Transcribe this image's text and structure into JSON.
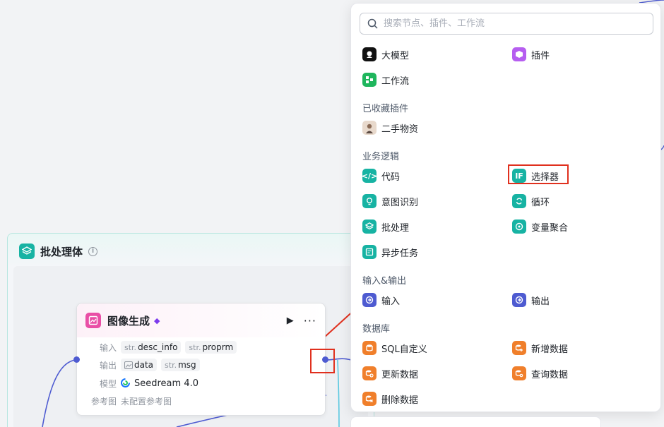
{
  "batch": {
    "title": "批处理体",
    "info_icon": "i"
  },
  "node": {
    "title": "图像生成",
    "input_label": "输入",
    "inputs": [
      {
        "type": "str.",
        "name": "desc_info"
      },
      {
        "type": "str.",
        "name": "proprm"
      }
    ],
    "output_label": "输出",
    "outputs": [
      {
        "type": "image",
        "name": "data"
      },
      {
        "type": "str.",
        "name": "msg"
      }
    ],
    "model_label": "模型",
    "model_value": "Seedream 4.0",
    "ref_label": "参考图",
    "ref_value": "未配置参考图"
  },
  "menu": {
    "search_placeholder": "搜索节点、插件、工作流",
    "top_items": [
      "大模型",
      "插件",
      "工作流"
    ],
    "sections": {
      "favorites": "已收藏插件",
      "business": "业务逻辑",
      "io": "输入&输出",
      "database": "数据库"
    },
    "favorites": [
      "二手物资"
    ],
    "business": [
      "代码",
      "选择器",
      "意图识别",
      "循环",
      "批处理",
      "变量聚合",
      "异步任务"
    ],
    "io": [
      "输入",
      "输出"
    ],
    "database": [
      "SQL自定义",
      "新增数据",
      "更新数据",
      "查询数据",
      "删除数据"
    ]
  },
  "colors": {
    "accent": "#17b3a3",
    "wire": "#4e5bd1",
    "highlight": "#e0301e"
  }
}
